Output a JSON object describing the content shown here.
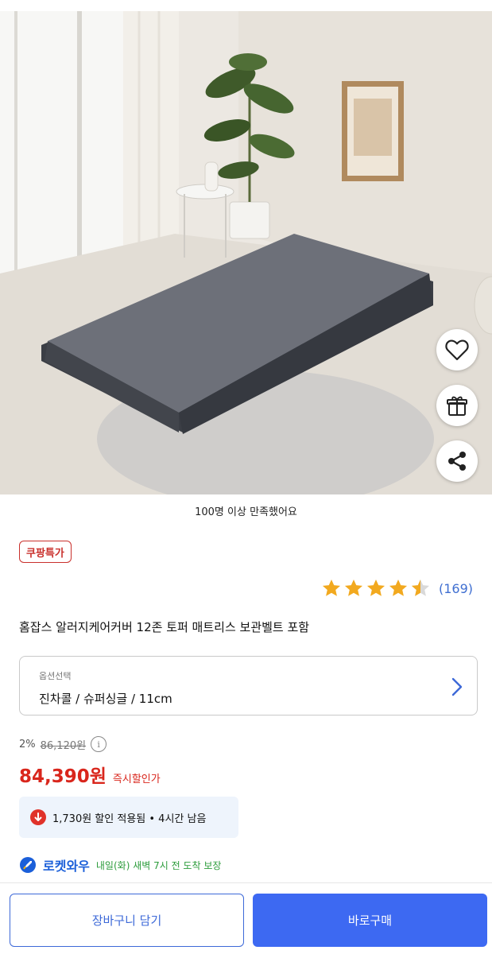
{
  "product_image": {
    "alt_subject": "mattress-photo"
  },
  "actions": {
    "like_icon": "heart-icon",
    "gift_icon": "gift-icon",
    "share_icon": "share-icon"
  },
  "caption": "100명 이상 만족했어요",
  "deal_badge": "쿠팡특가",
  "rating": {
    "value": 4.5,
    "max": 5,
    "count": "(169)",
    "star_color": "#f2a91f"
  },
  "title": "홈잡스 알러지케어커버 12존 토퍼 매트리스 보관벨트 포함",
  "option": {
    "label": "옵션선택",
    "value": "진차콜 / 슈퍼싱글 / 11cm"
  },
  "pricing": {
    "discount_rate": "2%",
    "original_price": "86,120원",
    "sale_price": "84,390원",
    "instant_label": "즉시할인가",
    "coupon_text": "1,730원 할인 적용됨 • 4시간 남음",
    "accent_color": "#d9261c"
  },
  "delivery": {
    "brand": "로켓와우",
    "eta": "내일(화) 새벽 7시 전 도착 보장"
  },
  "buttons": {
    "cart": "장바구니 담기",
    "buy": "바로구매",
    "primary_color": "#3d69f2"
  }
}
